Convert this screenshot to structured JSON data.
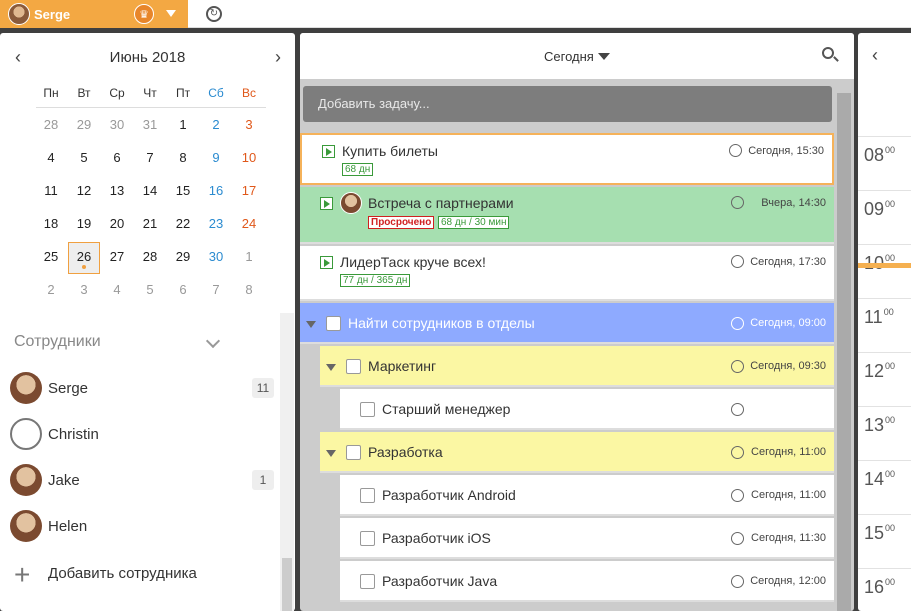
{
  "topbar": {
    "user_name": "Serge",
    "crown_icon": "crown-icon",
    "sync_icon": "sync-icon"
  },
  "calendar": {
    "title": "Июнь 2018",
    "weekdays": [
      "Пн",
      "Вт",
      "Ср",
      "Чт",
      "Пт",
      "Сб",
      "Вс"
    ],
    "weeks": [
      [
        "28",
        "29",
        "30",
        "31",
        "1",
        "2",
        "3"
      ],
      [
        "4",
        "5",
        "6",
        "7",
        "8",
        "9",
        "10"
      ],
      [
        "11",
        "12",
        "13",
        "14",
        "15",
        "16",
        "17"
      ],
      [
        "18",
        "19",
        "20",
        "21",
        "22",
        "23",
        "24"
      ],
      [
        "25",
        "26",
        "27",
        "28",
        "29",
        "30",
        "1"
      ],
      [
        "2",
        "3",
        "4",
        "5",
        "6",
        "7",
        "8"
      ]
    ],
    "selected": "26"
  },
  "employees": {
    "title": "Сотрудники",
    "items": [
      {
        "name": "Serge",
        "count": "11"
      },
      {
        "name": "Christin",
        "count": ""
      },
      {
        "name": "Jake",
        "count": "1"
      },
      {
        "name": "Helen",
        "count": ""
      }
    ],
    "add_label": "Добавить сотрудника"
  },
  "tasks_panel": {
    "title": "Сегодня",
    "add_placeholder": "Добавить задачу...",
    "tasks": [
      {
        "title": "Купить билеты",
        "due": "Сегодня, 15:30",
        "badge": "68 дн"
      },
      {
        "title": "Встреча с партнерами",
        "due": "Вчера, 14:30",
        "overdue": "Просрочено",
        "badge": "68 дн / 30 мин"
      },
      {
        "title": "ЛидерТаск круче всех!",
        "due": "Сегодня, 17:30",
        "badge": "77 дн / 365 дн"
      },
      {
        "title": "Найти сотрудников в отделы",
        "due": "Сегодня, 09:00"
      },
      {
        "title": "Маркетинг",
        "due": "Сегодня, 09:30"
      },
      {
        "title": "Старший менеджер",
        "due": ""
      },
      {
        "title": "Разработка",
        "due": "Сегодня, 11:00"
      },
      {
        "title": "Разработчик Android",
        "due": "Сегодня, 11:00"
      },
      {
        "title": "Разработчик iOS",
        "due": "Сегодня, 11:30"
      },
      {
        "title": "Разработчик Java",
        "due": "Сегодня, 12:00"
      }
    ],
    "colors": {
      "selected_border": "#f5b25a",
      "green": "#a6dfb0",
      "blue": "#8eaaff",
      "yellow": "#fbf7a3",
      "topbar": "#f3a843"
    }
  },
  "day_view": {
    "hours": [
      "08",
      "09",
      "10",
      "11",
      "12",
      "13",
      "14",
      "15",
      "16"
    ],
    "minutes": "00"
  }
}
